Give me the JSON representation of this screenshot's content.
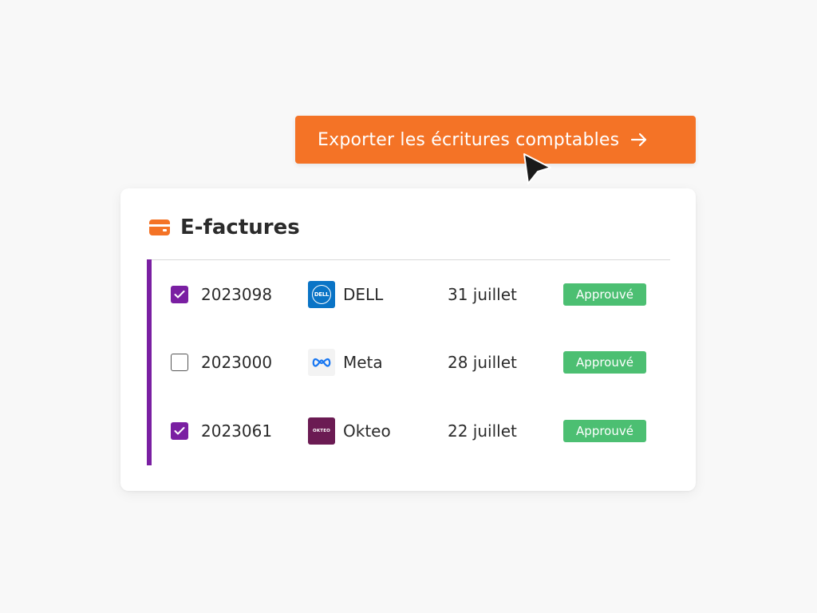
{
  "export_button": {
    "label": "Exporter les écritures comptables",
    "icon": "arrow-right-icon",
    "color": "#f47326"
  },
  "card": {
    "title": "E-factures",
    "icon": "wallet-icon",
    "accent_color": "#7a1fa2",
    "rows": [
      {
        "checked": true,
        "invoice": "2023098",
        "company": "DELL",
        "logo_text": "DELL",
        "logo_color": "#0a74c6",
        "date": "31 juillet",
        "status": "Approuvé"
      },
      {
        "checked": false,
        "invoice": "2023000",
        "company": "Meta",
        "logo_text": "",
        "logo_color": "#f3f3f3",
        "date": "28 juillet",
        "status": "Approuvé"
      },
      {
        "checked": true,
        "invoice": "2023061",
        "company": "Okteo",
        "logo_text": "OKTEO",
        "logo_color": "#6b1b53",
        "date": "22 juillet",
        "status": "Approuvé"
      }
    ]
  },
  "colors": {
    "status_approved": "#4cbf72",
    "checkbox_checked": "#7a1fa2"
  }
}
